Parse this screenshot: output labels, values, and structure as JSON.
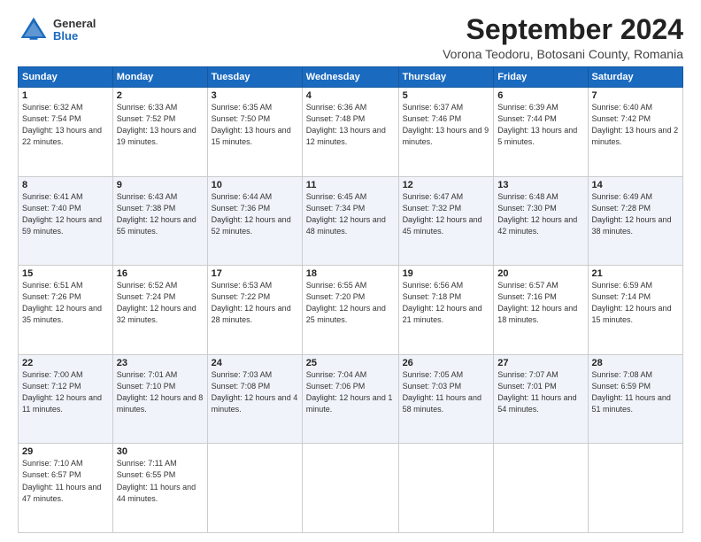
{
  "logo": {
    "general": "General",
    "blue": "Blue"
  },
  "title": {
    "month_year": "September 2024",
    "location": "Vorona Teodoru, Botosani County, Romania"
  },
  "days_of_week": [
    "Sunday",
    "Monday",
    "Tuesday",
    "Wednesday",
    "Thursday",
    "Friday",
    "Saturday"
  ],
  "weeks": [
    [
      {
        "day": "1",
        "sunrise": "6:32 AM",
        "sunset": "7:54 PM",
        "daylight": "13 hours and 22 minutes."
      },
      {
        "day": "2",
        "sunrise": "6:33 AM",
        "sunset": "7:52 PM",
        "daylight": "13 hours and 19 minutes."
      },
      {
        "day": "3",
        "sunrise": "6:35 AM",
        "sunset": "7:50 PM",
        "daylight": "13 hours and 15 minutes."
      },
      {
        "day": "4",
        "sunrise": "6:36 AM",
        "sunset": "7:48 PM",
        "daylight": "13 hours and 12 minutes."
      },
      {
        "day": "5",
        "sunrise": "6:37 AM",
        "sunset": "7:46 PM",
        "daylight": "13 hours and 9 minutes."
      },
      {
        "day": "6",
        "sunrise": "6:39 AM",
        "sunset": "7:44 PM",
        "daylight": "13 hours and 5 minutes."
      },
      {
        "day": "7",
        "sunrise": "6:40 AM",
        "sunset": "7:42 PM",
        "daylight": "13 hours and 2 minutes."
      }
    ],
    [
      {
        "day": "8",
        "sunrise": "6:41 AM",
        "sunset": "7:40 PM",
        "daylight": "12 hours and 59 minutes."
      },
      {
        "day": "9",
        "sunrise": "6:43 AM",
        "sunset": "7:38 PM",
        "daylight": "12 hours and 55 minutes."
      },
      {
        "day": "10",
        "sunrise": "6:44 AM",
        "sunset": "7:36 PM",
        "daylight": "12 hours and 52 minutes."
      },
      {
        "day": "11",
        "sunrise": "6:45 AM",
        "sunset": "7:34 PM",
        "daylight": "12 hours and 48 minutes."
      },
      {
        "day": "12",
        "sunrise": "6:47 AM",
        "sunset": "7:32 PM",
        "daylight": "12 hours and 45 minutes."
      },
      {
        "day": "13",
        "sunrise": "6:48 AM",
        "sunset": "7:30 PM",
        "daylight": "12 hours and 42 minutes."
      },
      {
        "day": "14",
        "sunrise": "6:49 AM",
        "sunset": "7:28 PM",
        "daylight": "12 hours and 38 minutes."
      }
    ],
    [
      {
        "day": "15",
        "sunrise": "6:51 AM",
        "sunset": "7:26 PM",
        "daylight": "12 hours and 35 minutes."
      },
      {
        "day": "16",
        "sunrise": "6:52 AM",
        "sunset": "7:24 PM",
        "daylight": "12 hours and 32 minutes."
      },
      {
        "day": "17",
        "sunrise": "6:53 AM",
        "sunset": "7:22 PM",
        "daylight": "12 hours and 28 minutes."
      },
      {
        "day": "18",
        "sunrise": "6:55 AM",
        "sunset": "7:20 PM",
        "daylight": "12 hours and 25 minutes."
      },
      {
        "day": "19",
        "sunrise": "6:56 AM",
        "sunset": "7:18 PM",
        "daylight": "12 hours and 21 minutes."
      },
      {
        "day": "20",
        "sunrise": "6:57 AM",
        "sunset": "7:16 PM",
        "daylight": "12 hours and 18 minutes."
      },
      {
        "day": "21",
        "sunrise": "6:59 AM",
        "sunset": "7:14 PM",
        "daylight": "12 hours and 15 minutes."
      }
    ],
    [
      {
        "day": "22",
        "sunrise": "7:00 AM",
        "sunset": "7:12 PM",
        "daylight": "12 hours and 11 minutes."
      },
      {
        "day": "23",
        "sunrise": "7:01 AM",
        "sunset": "7:10 PM",
        "daylight": "12 hours and 8 minutes."
      },
      {
        "day": "24",
        "sunrise": "7:03 AM",
        "sunset": "7:08 PM",
        "daylight": "12 hours and 4 minutes."
      },
      {
        "day": "25",
        "sunrise": "7:04 AM",
        "sunset": "7:06 PM",
        "daylight": "12 hours and 1 minute."
      },
      {
        "day": "26",
        "sunrise": "7:05 AM",
        "sunset": "7:03 PM",
        "daylight": "11 hours and 58 minutes."
      },
      {
        "day": "27",
        "sunrise": "7:07 AM",
        "sunset": "7:01 PM",
        "daylight": "11 hours and 54 minutes."
      },
      {
        "day": "28",
        "sunrise": "7:08 AM",
        "sunset": "6:59 PM",
        "daylight": "11 hours and 51 minutes."
      }
    ],
    [
      {
        "day": "29",
        "sunrise": "7:10 AM",
        "sunset": "6:57 PM",
        "daylight": "11 hours and 47 minutes."
      },
      {
        "day": "30",
        "sunrise": "7:11 AM",
        "sunset": "6:55 PM",
        "daylight": "11 hours and 44 minutes."
      },
      null,
      null,
      null,
      null,
      null
    ]
  ]
}
